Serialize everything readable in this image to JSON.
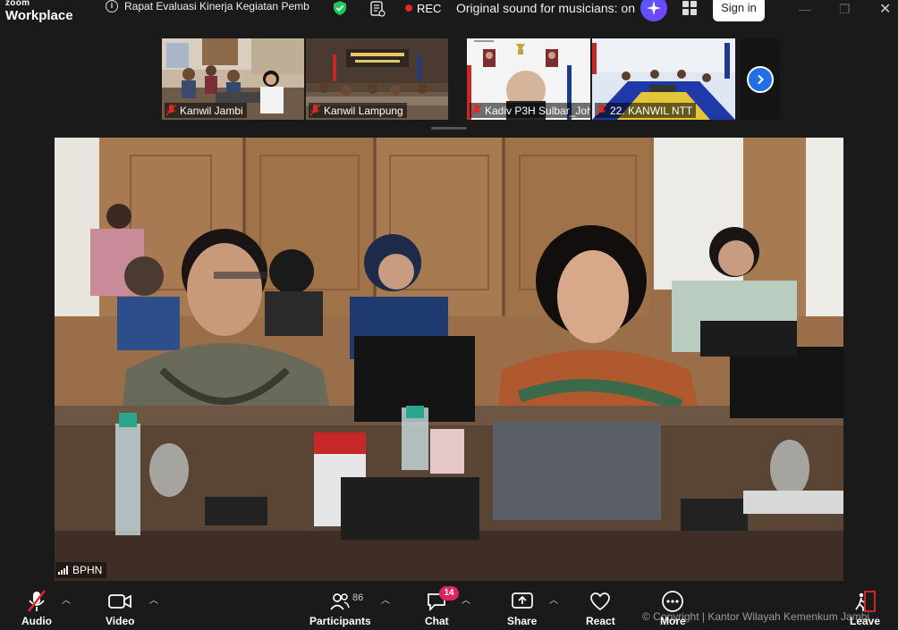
{
  "app": {
    "brand_top": "zoom",
    "brand_bottom": "Workplace"
  },
  "titlebar": {
    "meeting_title": "Rapat Evaluasi Kinerja Kegiatan Pemb",
    "rec_label": "REC",
    "original_sound": "Original sound for musicians: on",
    "signin_label": "Sign in"
  },
  "thumbnails": [
    {
      "name": "Kanwil Jambi",
      "muted": true
    },
    {
      "name": "Kanwil Lampung",
      "muted": true
    },
    {
      "name": "Kadiv P3H Sulbar_Joh...",
      "muted": true
    },
    {
      "name": "22. KANWIL NTT",
      "muted": true
    }
  ],
  "main_video": {
    "speaker_name": "BPHN"
  },
  "toolbar": {
    "audio_label": "Audio",
    "video_label": "Video",
    "participants_label": "Participants",
    "participants_count": "86",
    "chat_label": "Chat",
    "chat_badge": "14",
    "share_label": "Share",
    "react_label": "React",
    "more_label": "More",
    "leave_label": "Leave"
  },
  "watermark": "© Copyright | Kantor Wilayah Kemenkum Jambi",
  "colors": {
    "background": "#1a1a1a",
    "rec_dot": "#e02828",
    "next_button": "#1f6fe5",
    "chat_badge": "#e0245e",
    "shield": "#22c55e"
  }
}
